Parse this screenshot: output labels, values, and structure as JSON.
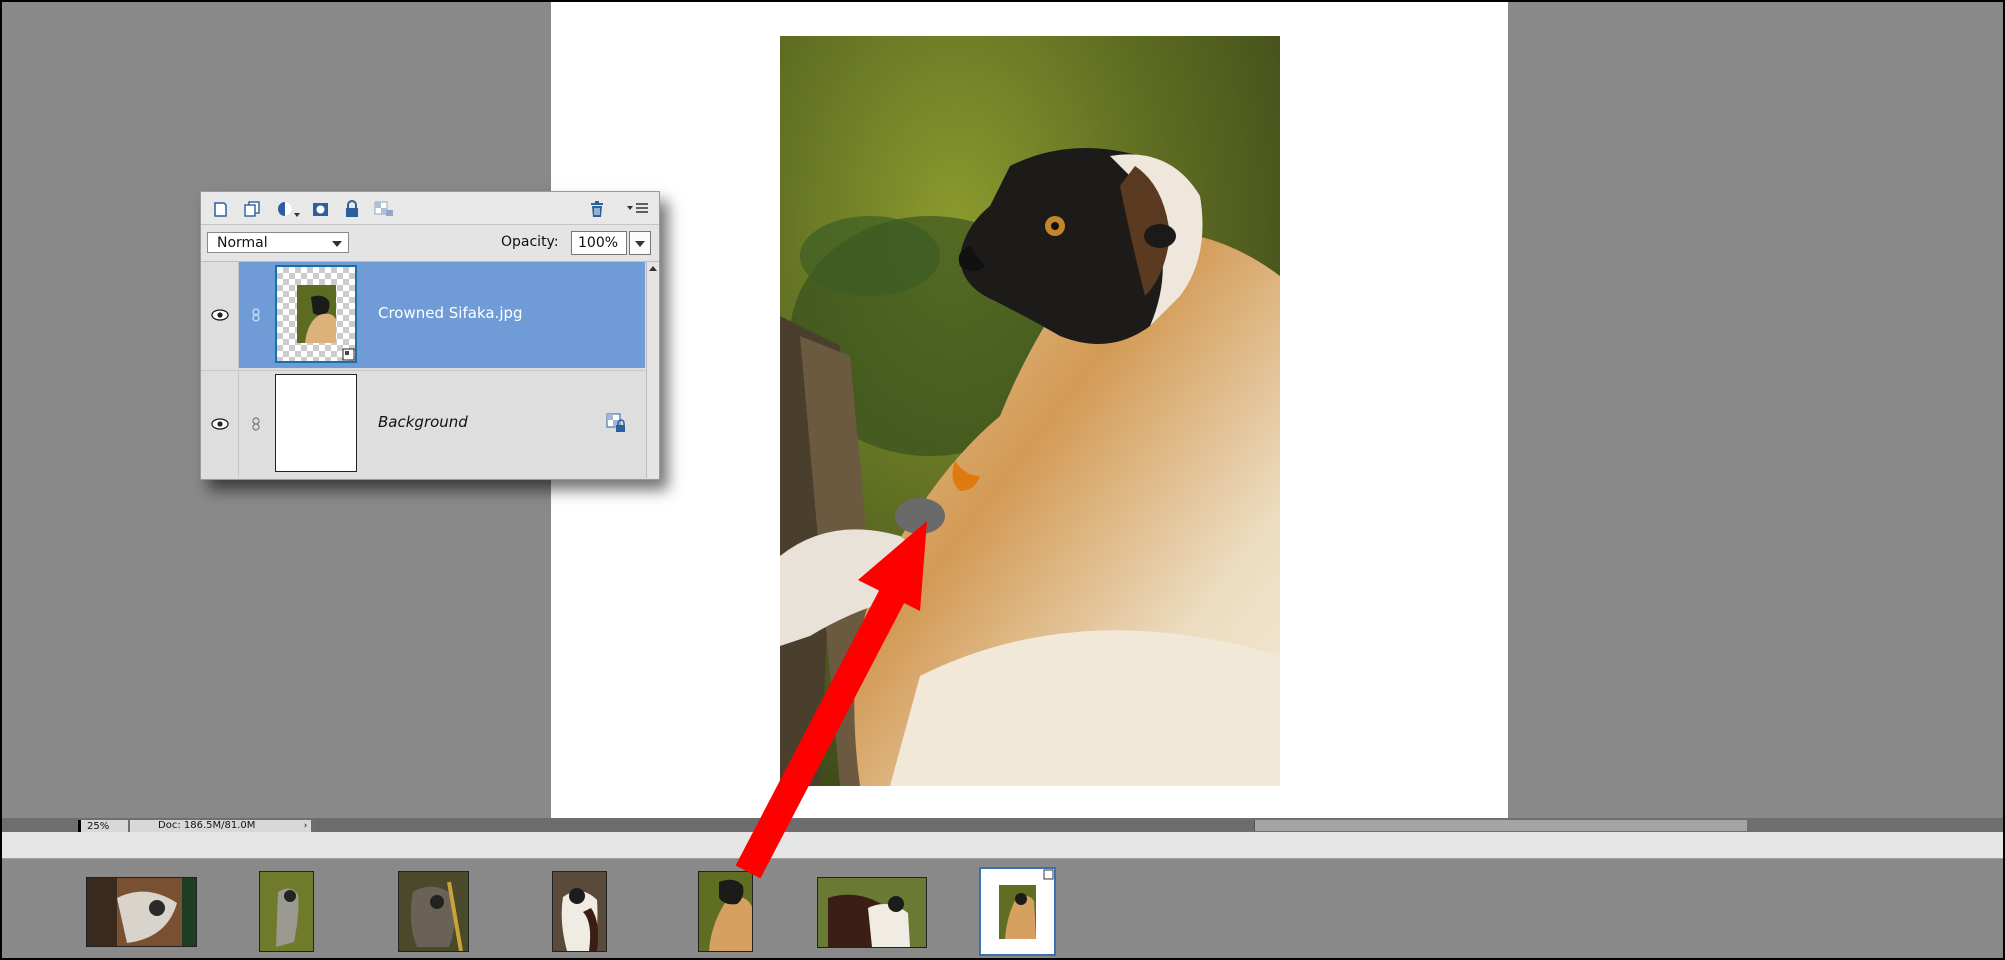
{
  "layers_panel": {
    "toolbar_icons": [
      "new-layer-icon",
      "new-group-icon",
      "adjustment-layer-icon",
      "layer-mask-icon",
      "lock-all-icon",
      "lock-transparency-icon",
      "trash-icon",
      "panel-menu-icon"
    ],
    "blend_mode": "Normal",
    "opacity_label": "Opacity:",
    "opacity_value": "100%",
    "layers": [
      {
        "name": "Crowned Sifaka.jpg",
        "selected": true
      },
      {
        "name": "Background",
        "selected": false
      }
    ]
  },
  "status_bar": {
    "zoom": "25%",
    "doc_info": "Doc: 186.5M/81.0M",
    "arrow": "›"
  },
  "colors": {
    "canvas_bg": "#898989",
    "selected_layer": "#6f9bd7",
    "panel_bg": "#dedede",
    "annotation_arrow": "#ff0000"
  }
}
